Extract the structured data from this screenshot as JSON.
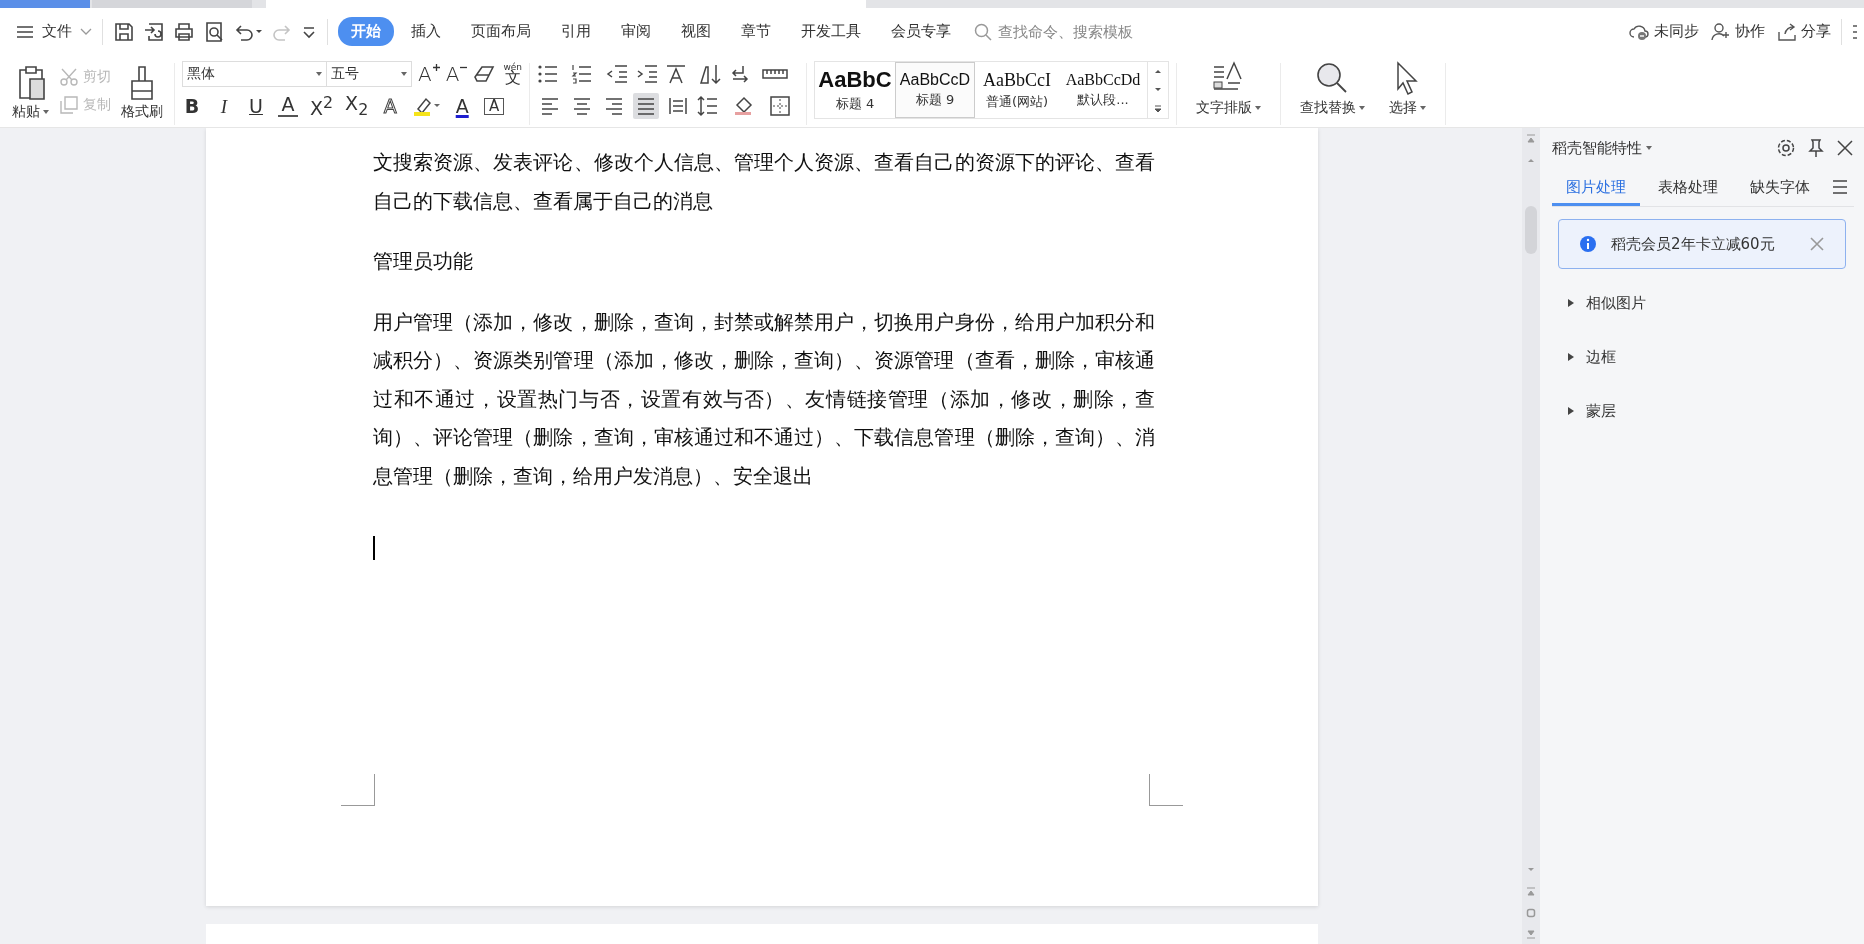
{
  "menu": {
    "file_label": "文件",
    "quick_access": [
      {
        "kind": "save",
        "disabled": false
      },
      {
        "kind": "export",
        "disabled": false
      },
      {
        "kind": "print",
        "disabled": false
      },
      {
        "kind": "preview",
        "disabled": false
      },
      {
        "kind": "undo",
        "disabled": false
      },
      {
        "kind": "redo",
        "disabled": true
      },
      {
        "kind": "customize",
        "disabled": false
      }
    ],
    "tabs": [
      {
        "label": "开始",
        "selected": true
      },
      {
        "label": "插入",
        "selected": false
      },
      {
        "label": "页面布局",
        "selected": false
      },
      {
        "label": "引用",
        "selected": false
      },
      {
        "label": "审阅",
        "selected": false
      },
      {
        "label": "视图",
        "selected": false
      },
      {
        "label": "章节",
        "selected": false
      },
      {
        "label": "开发工具",
        "selected": false
      },
      {
        "label": "会员专享",
        "selected": false
      }
    ],
    "search": {
      "placeholder": "查找命令、搜索模板"
    },
    "actions": [
      {
        "kind": "cloud",
        "label": "未同步"
      },
      {
        "kind": "collab",
        "label": "协作"
      },
      {
        "kind": "share",
        "label": "分享"
      }
    ]
  },
  "ribbon": {
    "clipboard": {
      "paste": "粘贴",
      "cut": {
        "label": "剪切",
        "disabled": true
      },
      "copy": {
        "label": "复制",
        "disabled": true
      },
      "format_painter": "格式刷"
    },
    "font": {
      "name": "黑体",
      "size": "五号",
      "pinyin": "wén",
      "pinyin_char": "文",
      "format_buttons": [
        {
          "kind": "bold",
          "glyph": "B"
        },
        {
          "kind": "italic",
          "glyph": "I"
        },
        {
          "kind": "underline",
          "glyph": "U"
        },
        {
          "kind": "strike",
          "glyph": "A"
        },
        {
          "kind": "sup",
          "glyph": "X$^{2}$"
        },
        {
          "kind": "sub",
          "glyph": "X$_{2}$"
        },
        {
          "kind": "effect",
          "glyph": "A"
        },
        {
          "kind": "highlight"
        },
        {
          "kind": "color",
          "glyph": "A"
        },
        {
          "kind": "border",
          "glyph": "A"
        }
      ],
      "grow": "A",
      "shrink": "A"
    },
    "align_buttons": [
      {
        "kind": "left",
        "selected": false
      },
      {
        "kind": "center",
        "selected": false
      },
      {
        "kind": "right",
        "selected": false
      },
      {
        "kind": "justify",
        "selected": true
      },
      {
        "kind": "distributed",
        "selected": false
      }
    ],
    "styles": [
      {
        "preview": "AaBbC",
        "label": "标题 4",
        "kind": "heavy",
        "selected": false
      },
      {
        "preview": "AaBbCcD",
        "label": "标题 9",
        "kind": "sans",
        "selected": true
      },
      {
        "preview": "AaBbCcI",
        "label": "普通(网站)",
        "kind": "serif",
        "selected": false
      },
      {
        "preview": "AaBbCcDd",
        "label": "默认段...",
        "kind": "serif-small",
        "selected": false
      }
    ],
    "typesetting": "文字排版",
    "find_replace": "查找替换",
    "select": "选择"
  },
  "document": {
    "paragraphs": [
      "文搜索资源、发表评论、修改个人信息、管理个人资源、查看自己的资源下的评论、查看自己的下载信息、查看属于自己的消息",
      "管理员功能",
      "用户管理（添加，修改，删除，查询，封禁或解禁用户，切换用户身份，给用户加积分和减积分）、资源类别管理（添加，修改，删除，查询）、资源管理（查看，删除，审核通过和不通过，设置热门与否，设置有效与否）、友情链接管理（添加，修改，删除，查询）、评论管理（删除，查询，审核通过和不通过）、下载信息管理（删除，查询）、消息管理（删除，查询，给用户发消息）、安全退出"
    ]
  },
  "side_panel": {
    "title": "稻壳智能特性",
    "tabs": [
      {
        "label": "图片处理",
        "selected": true
      },
      {
        "label": "表格处理",
        "selected": false
      },
      {
        "label": "缺失字体",
        "selected": false
      }
    ],
    "banner": "稻壳会员2年卡立减60元",
    "sections": [
      {
        "label": "相似图片",
        "expanded": false
      },
      {
        "label": "边框",
        "expanded": false
      },
      {
        "label": "蒙层",
        "expanded": false
      }
    ]
  }
}
